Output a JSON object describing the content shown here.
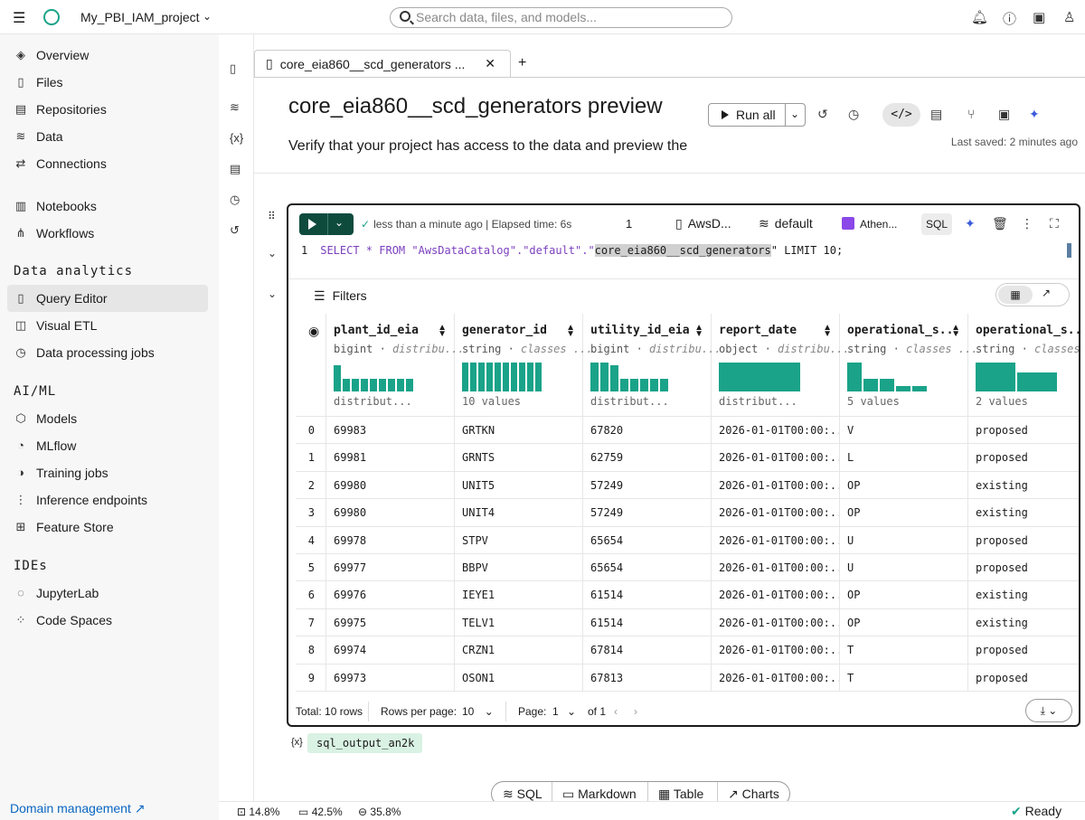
{
  "topbar": {
    "project_name": "My_PBI_IAM_project",
    "search_placeholder": "Search data, files, and models..."
  },
  "sidebar": {
    "items_top": [
      {
        "label": "Overview",
        "icon": "overview-icon"
      },
      {
        "label": "Files",
        "icon": "file-icon"
      },
      {
        "label": "Repositories",
        "icon": "repo-icon"
      },
      {
        "label": "Data",
        "icon": "database-icon"
      },
      {
        "label": "Connections",
        "icon": "connection-icon"
      }
    ],
    "items_mid": [
      {
        "label": "Notebooks",
        "icon": "notebook-icon"
      },
      {
        "label": "Workflows",
        "icon": "workflow-icon"
      }
    ],
    "section_data": "Data analytics",
    "items_data": [
      {
        "label": "Query Editor",
        "icon": "book-icon",
        "active": true
      },
      {
        "label": "Visual ETL",
        "icon": "etl-icon"
      },
      {
        "label": "Data processing jobs",
        "icon": "jobs-icon"
      }
    ],
    "section_ai": "AI/ML",
    "items_ai": [
      {
        "label": "Models",
        "icon": "cube-icon"
      },
      {
        "label": "MLflow",
        "icon": "mlflow-icon"
      },
      {
        "label": "Training jobs",
        "icon": "training-icon"
      },
      {
        "label": "Inference endpoints",
        "icon": "endpoint-icon"
      },
      {
        "label": "Feature Store",
        "icon": "feature-store-icon"
      }
    ],
    "section_ide": "IDEs",
    "items_ide": [
      {
        "label": "JupyterLab",
        "icon": "jupyter-icon"
      },
      {
        "label": "Code Spaces",
        "icon": "code-spaces-icon"
      }
    ],
    "domain_link": "Domain management"
  },
  "tab": {
    "label": "core_eia860__scd_generators ..."
  },
  "notebook": {
    "title": "core_eia860__scd_generators preview",
    "description": "Verify that your project has access to the data and preview the",
    "run_all": "Run all",
    "last_saved": "Last saved: 2 minutes ago"
  },
  "cell": {
    "status": "less than a minute ago | Elapsed time: 6s",
    "exec_count": "1",
    "catalog": "AwsD...",
    "database": "default",
    "engine": "Athen...",
    "language": "SQL",
    "line_number": "1",
    "code_pre": "SELECT * FROM \"AwsDataCatalog\".\"default\".\"",
    "code_table": "core_eia860__scd_generators",
    "code_post": "\" LIMIT 10;",
    "filters": "Filters"
  },
  "table": {
    "columns": [
      {
        "name": "plant_id_eia",
        "type": "bigint",
        "kind": "distribu...",
        "footer": "distribut...",
        "hist": [
          0.9,
          0.45,
          0.45,
          0.45,
          0.45,
          0.45,
          0.45,
          0.45,
          0.45
        ]
      },
      {
        "name": "generator_id",
        "type": "string",
        "kind": "classes ...",
        "footer": "10 values",
        "hist": [
          1,
          1,
          1,
          1,
          1,
          1,
          1,
          1,
          1,
          1
        ]
      },
      {
        "name": "utility_id_eia",
        "type": "bigint",
        "kind": "distribu...",
        "footer": "distribut...",
        "hist": [
          1,
          1,
          0.9,
          0.45,
          0.45,
          0.45,
          0.45,
          0.45
        ]
      },
      {
        "name": "report_date",
        "type": "object",
        "kind": "distribu...",
        "footer": "distribut...",
        "hist": [
          1
        ]
      },
      {
        "name": "operational_s...",
        "type": "string",
        "kind": "classes ...",
        "footer": "5 values",
        "hist": [
          1,
          0.45,
          0.45,
          0.2,
          0.2
        ]
      },
      {
        "name": "operational_s...",
        "type": "string",
        "kind": "classes ...",
        "footer": "2 values",
        "hist": [
          1,
          0.65
        ]
      }
    ],
    "rows": [
      [
        "0",
        "69983",
        "GRTKN",
        "67820",
        "2026-01-01T00:00:...",
        "V",
        "proposed"
      ],
      [
        "1",
        "69981",
        "GRNTS",
        "62759",
        "2026-01-01T00:00:...",
        "L",
        "proposed"
      ],
      [
        "2",
        "69980",
        "UNIT5",
        "57249",
        "2026-01-01T00:00:...",
        "OP",
        "existing"
      ],
      [
        "3",
        "69980",
        "UNIT4",
        "57249",
        "2026-01-01T00:00:...",
        "OP",
        "existing"
      ],
      [
        "4",
        "69978",
        "STPV",
        "65654",
        "2026-01-01T00:00:...",
        "U",
        "proposed"
      ],
      [
        "5",
        "69977",
        "BBPV",
        "65654",
        "2026-01-01T00:00:...",
        "U",
        "proposed"
      ],
      [
        "6",
        "69976",
        "IEYE1",
        "61514",
        "2026-01-01T00:00:...",
        "OP",
        "existing"
      ],
      [
        "7",
        "69975",
        "TELV1",
        "61514",
        "2026-01-01T00:00:...",
        "OP",
        "existing"
      ],
      [
        "8",
        "69974",
        "CRZN1",
        "67814",
        "2026-01-01T00:00:...",
        "T",
        "proposed"
      ],
      [
        "9",
        "69973",
        "OSON1",
        "67813",
        "2026-01-01T00:00:...",
        "T",
        "proposed"
      ]
    ],
    "footer": {
      "total": "Total: 10 rows",
      "rows_per_page_label": "Rows per page:",
      "rows_per_page": "10",
      "page_label": "Page:",
      "page": "1",
      "of_pages": "of 1"
    }
  },
  "output_var": "sql_output_an2k",
  "add_cell": {
    "sql": "SQL",
    "markdown": "Markdown",
    "table": "Table",
    "charts": "Charts"
  },
  "statusbar": {
    "cpu": "14.8%",
    "memory": "42.5%",
    "disk": "35.8%",
    "kernel_status": "Ready"
  },
  "colors": {
    "accent": "#1aa389",
    "run_button": "#0e4b3d",
    "link": "#0a66c2"
  }
}
